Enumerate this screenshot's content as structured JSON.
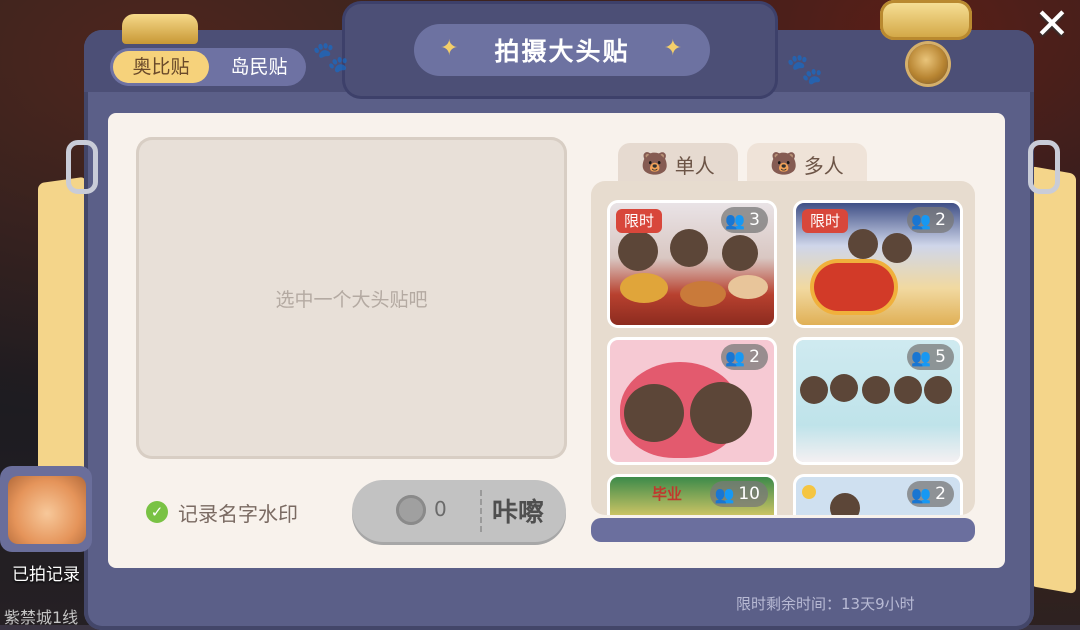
{
  "title": "拍摄大头贴",
  "category_tabs": {
    "active": "奥比贴",
    "inactive": "岛民贴"
  },
  "preview_placeholder": "选中一个大头贴吧",
  "watermark_label": "记录名字水印",
  "shoot_button": {
    "cost": "0",
    "label": "咔嚓"
  },
  "people_tabs": {
    "single": "单人",
    "multi": "多人"
  },
  "stickers": [
    {
      "badge": "限时",
      "count": "3",
      "theme": "hotpot"
    },
    {
      "badge": "限时",
      "count": "2",
      "theme": "dragon"
    },
    {
      "badge": "",
      "count": "2",
      "theme": "heart"
    },
    {
      "badge": "",
      "count": "5",
      "theme": "party"
    },
    {
      "badge": "",
      "count": "10",
      "theme": "graduation",
      "sign": "毕业"
    },
    {
      "badge": "",
      "count": "2",
      "theme": "picnic"
    }
  ],
  "record_label": "已拍记录",
  "city_label": "紫禁城1线",
  "timer_text": "限时剩余时间：13天9小时",
  "colors": {
    "frame": "#5b5f88",
    "panel": "#f8f2ec",
    "accent_gold": "#f6d27b",
    "badge_red": "#d8473b",
    "check_green": "#79c244"
  }
}
